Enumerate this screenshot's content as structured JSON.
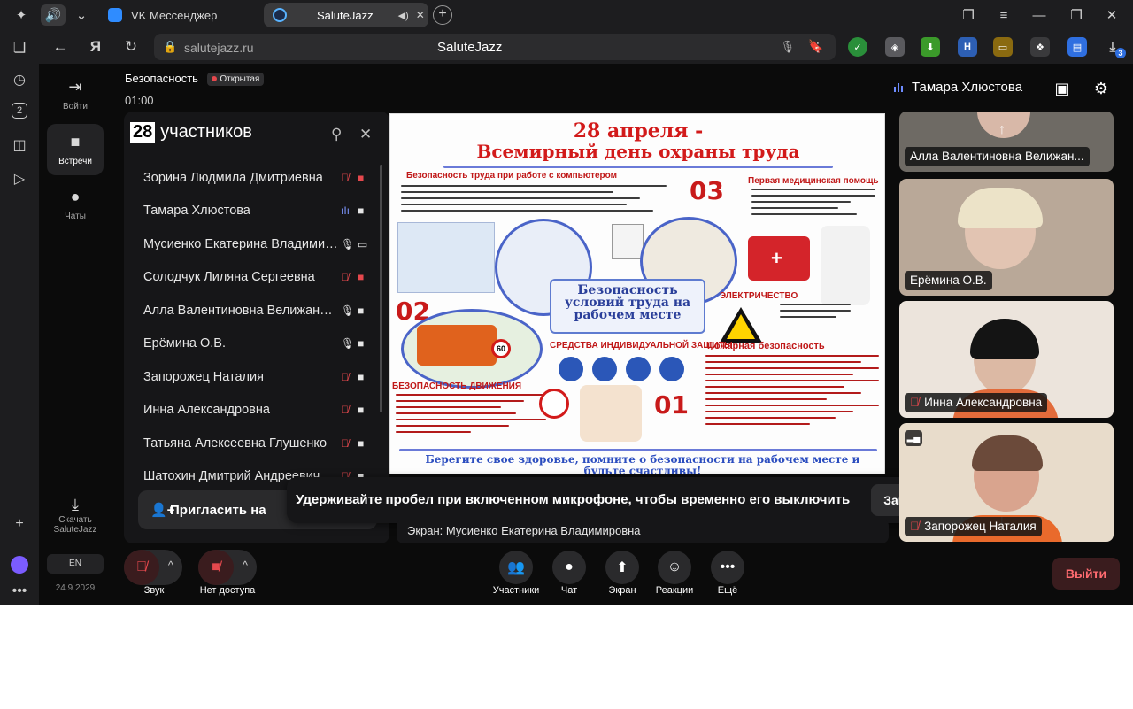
{
  "browser": {
    "tabs": [
      {
        "label": "VK Мессенджер",
        "active": false
      },
      {
        "label": "SaluteJazz",
        "active": true
      }
    ],
    "address": {
      "url": "salutejazz.ru",
      "page_title": "SaluteJazz"
    },
    "extension_badge": "3"
  },
  "sidebar": {
    "items": [
      {
        "label": "Войти",
        "icon": "login-icon"
      },
      {
        "label": "Встречи",
        "icon": "camera-icon"
      },
      {
        "label": "Чаты",
        "icon": "chat-icon"
      },
      {
        "label": "Скачать SaluteJazz",
        "icon": "download-icon"
      }
    ],
    "lang": "EN",
    "date": "24.9.2029"
  },
  "meeting": {
    "title": "Безопасность",
    "badge": "Открытая",
    "timer": "01:00",
    "current_user": "Тамара Хлюстова"
  },
  "participants": {
    "count": "28",
    "title": "участников",
    "list": [
      {
        "name": "Зорина Людмила Дмитриевна"
      },
      {
        "name": "Тамара Хлюстова"
      },
      {
        "name": "Мусиенко Екатерина Владимировна"
      },
      {
        "name": "Солодчук Лиляна Сергеевна"
      },
      {
        "name": "Алла Валентиновна Велижанина"
      },
      {
        "name": "Ерёмина О.В."
      },
      {
        "name": "Запорожец Наталия"
      },
      {
        "name": "Инна Александровна"
      },
      {
        "name": "Татьяна Алексеевна Глушенко"
      },
      {
        "name": "Шатохин Дмитрий Андреевич"
      }
    ],
    "invite_label": "Пригласить на"
  },
  "screen_share": {
    "poster": {
      "title_line1": "28 апреля -",
      "title_line2": "Всемирный день охраны труда",
      "section_computer": "Безопасность труда при работе с компьютером",
      "section_firstaid": "Первая медицинская помощь",
      "section_electric": "ЭЛЕКТРИЧЕСТВО",
      "section_road": "БЕЗОПАСНОСТЬ ДВИЖЕНИЯ",
      "section_ppe": "СРЕДСТВА ИНДИВИДУАЛЬНОЙ ЗАЩИТЫ",
      "section_fire": "Пожарная безопасность",
      "center_text": "Безопасность условий труда на рабочем месте",
      "num_03": "03",
      "num_02": "02",
      "num_01": "01",
      "footer": "Берегите свое здоровье, помните о безопасности на рабочем месте и будьте счастливы!"
    },
    "caption": "Экран: Мусиенко Екатерина Владимировна"
  },
  "toast": {
    "message": "Удерживайте пробел при включенном микрофоне, чтобы временно его выключить",
    "close_label": "Закрыть"
  },
  "video_tiles": [
    {
      "name": "Алла Валентиновна Велижан..."
    },
    {
      "name": "Ерёмина О.В."
    },
    {
      "name": "Инна Александровна"
    },
    {
      "name": "Запорожец Наталия"
    }
  ],
  "toolbar": {
    "sound_label": "Звук",
    "camera_label": "Нет доступа",
    "participants_label": "Участники",
    "chat_label": "Чат",
    "screen_label": "Экран",
    "reactions_label": "Реакции",
    "more_label": "Ещё",
    "leave_label": "Выйти"
  },
  "colors": {
    "background": "#0b0b0b",
    "panel": "#161618",
    "muted_red": "#e5484d",
    "speaking_blue": "#7d96ff",
    "poster_red": "#d21a1a",
    "poster_blue": "#2b4dbf"
  }
}
